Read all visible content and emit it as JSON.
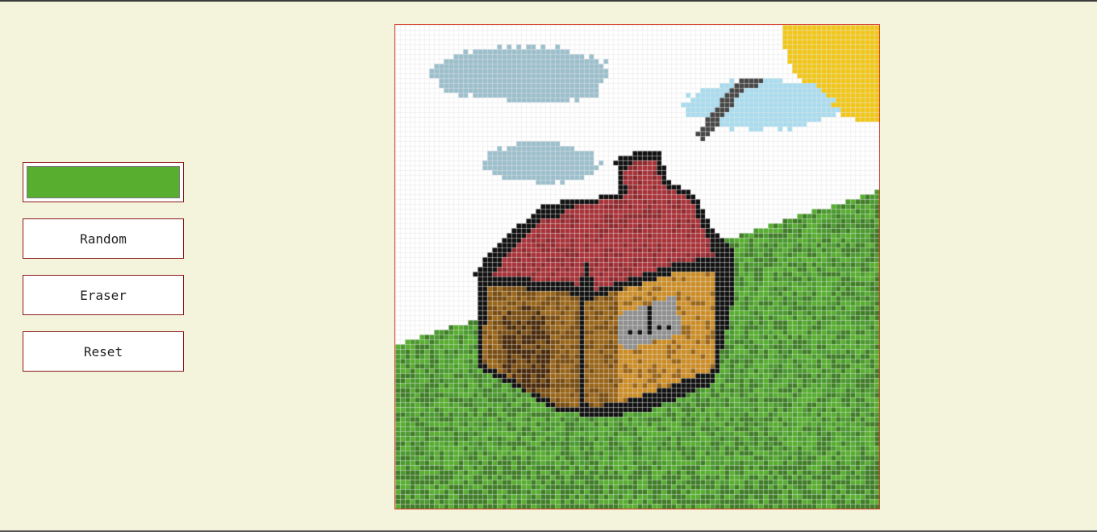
{
  "controls": {
    "color_picker": {
      "value": "#57ae2f"
    },
    "random_label": "Random",
    "eraser_label": "Eraser",
    "reset_label": "Reset"
  },
  "canvas": {
    "grid_cells": 100,
    "grid_line_color": "#e6e6e6",
    "palette": {
      "sky": "#ffffff",
      "sun": "#f2c617",
      "cloud_grey": "#9cbfcc",
      "cloud_blue": "#a8dcee",
      "smoke": "#474747",
      "grass_dark": "#3f7d26",
      "grass_mid": "#4b9a2f",
      "grass_light": "#57ae2f",
      "outline": "#111111",
      "roof": "#a83238",
      "roof_dark": "#8e2a2f",
      "wall_dark": "#7a4d10",
      "wall_mid": "#9a6518",
      "wall_light": "#cc8d25",
      "door": "#4a2a0a",
      "window": "#8f8f8f"
    }
  }
}
